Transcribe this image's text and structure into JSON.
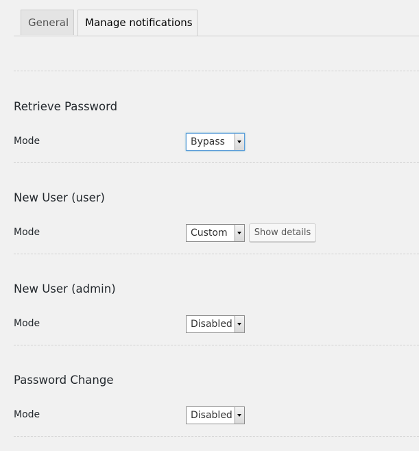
{
  "tabs": [
    {
      "label": "General",
      "active": false
    },
    {
      "label": "Manage notifications",
      "active": true
    }
  ],
  "sections": [
    {
      "title": "Retrieve Password",
      "mode_label": "Mode",
      "mode_value": "Bypass",
      "focused": true
    },
    {
      "title": "New User (user)",
      "mode_label": "Mode",
      "mode_value": "Custom",
      "details_button": "Show details"
    },
    {
      "title": "New User (admin)",
      "mode_label": "Mode",
      "mode_value": "Disabled"
    },
    {
      "title": "Password Change",
      "mode_label": "Mode",
      "mode_value": "Disabled"
    }
  ],
  "colors": {
    "background": "#f1f1f1",
    "focus": "#5b9dd9"
  },
  "icons": [
    "dropdown-arrow-icon"
  ]
}
